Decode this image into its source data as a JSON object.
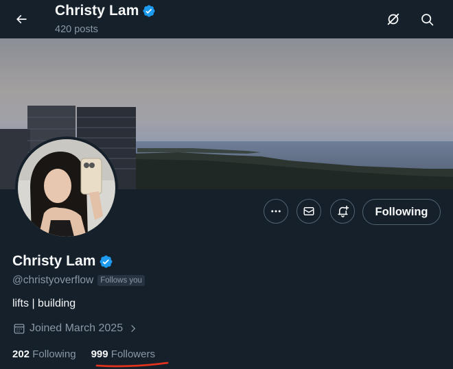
{
  "header": {
    "title": "Christy Lam",
    "post_count": "420 posts"
  },
  "profile": {
    "name": "Christy Lam",
    "handle": "@christyoverflow",
    "follows_you_badge": "Follows you",
    "bio": "lifts | building",
    "joined": "Joined March 2025",
    "following_count": "202",
    "following_label": "Following",
    "followers_count": "999",
    "followers_label": "Followers"
  },
  "actions": {
    "following_button": "Following"
  },
  "colors": {
    "background": "#15202b",
    "verified_badge": "#1d9bf0",
    "secondary_text": "#8b98a5",
    "annotation_underline": "#e0321c"
  },
  "icons": {
    "back": "arrow-left-icon",
    "grok": "grok-icon",
    "search": "search-icon",
    "more": "more-dots-icon",
    "message": "mail-icon",
    "notify": "bell-plus-icon",
    "calendar": "calendar-icon",
    "verified": "verified-badge-icon"
  }
}
